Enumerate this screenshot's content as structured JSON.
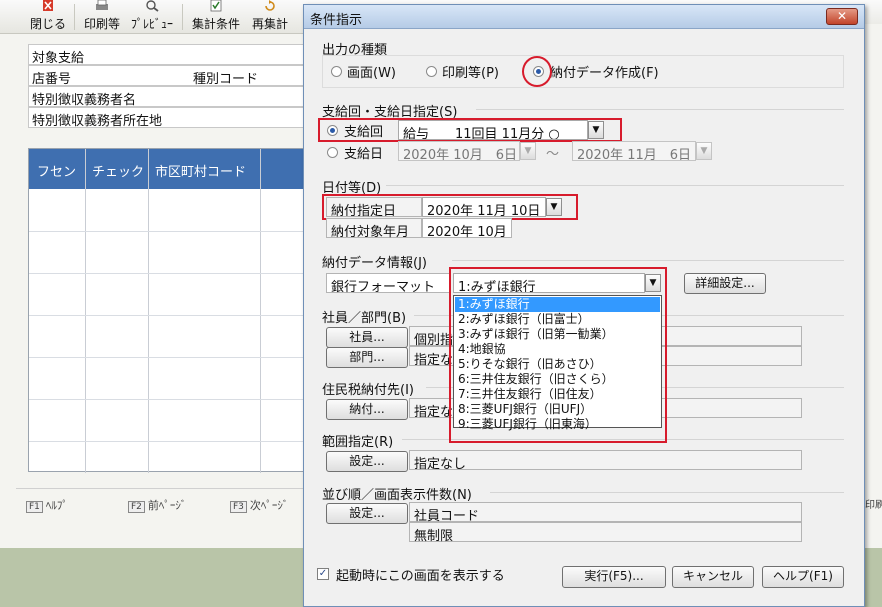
{
  "background_app": {
    "toolbar": {
      "close_label": "閉じる",
      "print_label": "印刷等",
      "preview_label": "ﾌﾟﾚﾋﾞｭｰ",
      "conditions_label": "集計条件",
      "recalc_label": "再集計"
    },
    "info_labels": {
      "payer": "対象支給",
      "store_no": "店番号",
      "type_code": "種別コード",
      "collector_name": "特別徴収義務者名",
      "collector_address": "特別徴収義務者所在地"
    },
    "grid_headers": [
      "フセン",
      "チェック",
      "市区町村コード"
    ],
    "fkeys": [
      {
        "key": "F1",
        "label": "ﾍﾙﾌﾟ"
      },
      {
        "key": "F2",
        "label": "前ﾍﾟｰｼﾞ"
      },
      {
        "key": "F3",
        "label": "次ﾍﾟｰｼﾞ"
      }
    ],
    "fkey_right_label": "印刷"
  },
  "dialog": {
    "title": "条件指示",
    "close_glyph": "✕",
    "output_type": {
      "label": "出力の種類",
      "options": [
        "画面(W)",
        "印刷等(P)",
        "納付データ作成(F)"
      ],
      "selected_index": 2
    },
    "payment_round": {
      "label": "支給回・支給日指定(S)",
      "round_radio": "支給回",
      "round_value": "給与　　11回目 11月分 ○",
      "date_radio": "支給日",
      "date_from": "2020年 10月　6日",
      "tilde": "～",
      "date_to": "2020年 11月　6日"
    },
    "dates": {
      "label": "日付等(D)",
      "pay_date_label": "納付指定日",
      "pay_date_value": "2020年 11月 10日",
      "target_month_label": "納付対象年月",
      "target_month_value": "2020年 10月"
    },
    "payment_data": {
      "label": "納付データ情報(J)",
      "format_label": "銀行フォーマット",
      "format_value": "1:みずほ銀行",
      "detail_button": "詳細設定...",
      "options": [
        "1:みずほ銀行",
        "2:みずほ銀行（旧富士）",
        "3:みずほ銀行（旧第一勧業）",
        "4:地銀協",
        "5:りそな銀行（旧あさひ）",
        "6:三井住友銀行（旧さくら）",
        "7:三井住友銀行（旧住友）",
        "8:三菱UFJ銀行（旧UFJ）",
        "9:三菱UFJ銀行（旧東海）"
      ],
      "selected_index": 0
    },
    "employee": {
      "label": "社員／部門(B)",
      "employee_button": "社員...",
      "employee_value": "個別指",
      "dept_button": "部門...",
      "dept_value": "指定な"
    },
    "tax_destination": {
      "label": "住民税納付先(I)",
      "button": "納付...",
      "value": "指定な"
    },
    "range": {
      "label": "範囲指定(R)",
      "button": "設定...",
      "value": "指定なし"
    },
    "sort": {
      "label": "並び順／画面表示件数(N)",
      "button": "設定...",
      "sort_value": "社員コード",
      "count_value": "無制限"
    },
    "show_on_start": {
      "label": "起動時にこの画面を表示する",
      "checked": true,
      "check_glyph": "✓"
    },
    "buttons": {
      "run": "実行(F5)...",
      "cancel": "キャンセル",
      "help": "ヘルプ(F1)"
    }
  },
  "colors": {
    "highlight_red": "#d71b2c",
    "grid_header_blue": "#3f6fb0",
    "selection_blue": "#3399ff"
  }
}
